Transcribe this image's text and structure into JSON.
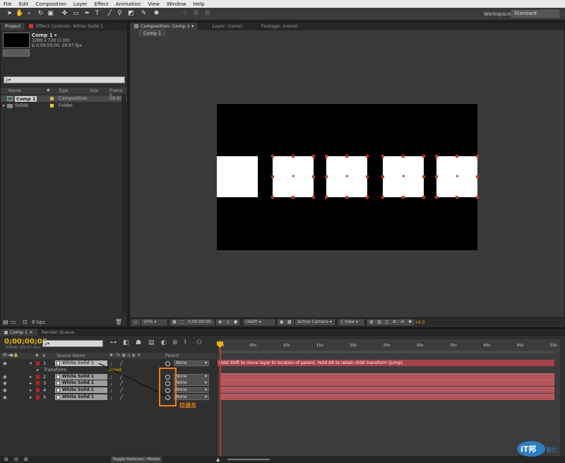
{
  "menu": [
    "File",
    "Edit",
    "Composition",
    "Layer",
    "Effect",
    "Animation",
    "View",
    "Window",
    "Help"
  ],
  "workspace": {
    "label": "Workspace:",
    "value": "Standard"
  },
  "project_panel": {
    "tabs": [
      "Project",
      "Effect Controls: White Solid 1"
    ],
    "comp_name": "Comp 1 ▾",
    "comp_size": "1280 x 720 (1.00)",
    "comp_duration": "Δ 0;00;50;00, 29.97 fps",
    "search_placeholder": "ρ▾",
    "columns": [
      "Name",
      "Type",
      "Size",
      "Frame R..."
    ],
    "items": [
      {
        "name": "Comp 1",
        "type": "Composition",
        "rate": "29.97"
      },
      {
        "name": "Solids",
        "type": "Folder",
        "rate": ""
      }
    ],
    "bpc": "8 bpc"
  },
  "viewer": {
    "tabs": [
      "Composition: Comp 1",
      "Layer: (none)",
      "Footage: (none)"
    ],
    "subtab": "Comp 1",
    "zoom": "50%",
    "time": "0;00;00;00",
    "resolution": "(Half)",
    "camera": "Active Camera",
    "views": "1 View",
    "exposure": "+0.0"
  },
  "timeline": {
    "tabs": [
      "Comp 1",
      "Render Queue"
    ],
    "timecode": "0;00;00;00",
    "fps": "00000 (29.97 fps)",
    "search_placeholder": "ρ▾",
    "columns": {
      "hash": "#",
      "source": "Source Name",
      "parent": "Parent"
    },
    "ticks": [
      "0s",
      "05s",
      "10s",
      "15s",
      "20s",
      "25s",
      "30s",
      "35s",
      "40s",
      "45s",
      "50s"
    ],
    "hint": "Hold Shift to move layer to location of parent. Hold Alt to retain child transform (jump).",
    "transform_label": "Transform",
    "reset_label": "Reset",
    "layers": [
      {
        "num": "1",
        "name": "White Solid 1",
        "parent": "None"
      },
      {
        "num": "2",
        "name": "White Solid 1",
        "parent": "None"
      },
      {
        "num": "3",
        "name": "White Solid 1",
        "parent": "None"
      },
      {
        "num": "4",
        "name": "White Solid 1",
        "parent": "None"
      },
      {
        "num": "5",
        "name": "White Solid 1",
        "parent": "None"
      }
    ],
    "annotation": "拉過去",
    "toggle_label": "Toggle Switches / Modes"
  },
  "watermark": {
    "text": "iT邦",
    "sub": "幫忙"
  },
  "colors": {
    "accent": "#e8b400",
    "annotation": "#f07e1a",
    "layer_bar": "#b5555c",
    "handle": "#c0392b"
  }
}
